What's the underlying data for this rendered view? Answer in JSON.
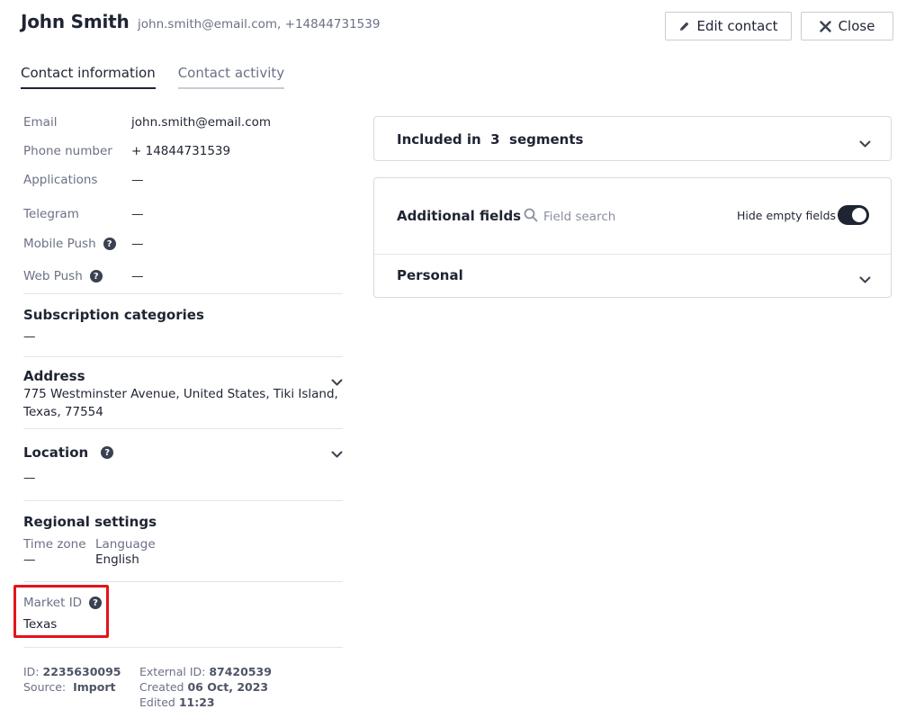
{
  "header": {
    "name": "John Smith",
    "subtitle": "john.smith@email.com, +14844731539",
    "edit_label": "Edit contact",
    "close_label": "Close"
  },
  "tabs": [
    {
      "label": "Contact information",
      "active": true
    },
    {
      "label": "Contact activity",
      "active": false
    }
  ],
  "fields": [
    {
      "label": "Email",
      "value": "john.smith@email.com"
    },
    {
      "label": "Phone number",
      "value": "+ 14844731539"
    },
    {
      "label": "Applications",
      "value": "—"
    },
    {
      "label": "Telegram",
      "value": "—"
    },
    {
      "label": "Mobile Push",
      "value": "—"
    },
    {
      "label": "Web Push",
      "value": "—"
    }
  ],
  "subscription": {
    "title": "Subscription categories",
    "value": "—"
  },
  "address": {
    "title": "Address",
    "line1": "775 Westminster Avenue, United States, Tiki Island,",
    "line2": "Texas, 77554"
  },
  "location": {
    "title": "Location",
    "value": "—"
  },
  "regional": {
    "title": "Regional settings",
    "timezone_label": "Time zone",
    "timezone_value": "—",
    "language_label": "Language",
    "language_value": "English"
  },
  "market": {
    "label": "Market ID",
    "value": "Texas"
  },
  "meta": {
    "id_label": "ID:",
    "id_value": "2235630095",
    "source_label": "Source:",
    "source_value": "Import",
    "external_label": "External ID:",
    "external_value": "87420539",
    "created_label": "Created",
    "created_value": "06 Oct, 2023",
    "edited_label": "Edited",
    "edited_value": "11:23"
  },
  "segments": {
    "prefix": "Included in",
    "count": "3",
    "suffix": "segments"
  },
  "additional": {
    "title": "Additional fields",
    "search_placeholder": "Field search",
    "toggle_label": "Hide empty fields",
    "toggle_on": true,
    "group": "Personal"
  },
  "colors": {
    "accent": "#1f2433",
    "highlight": "#e3141b",
    "muted": "#6b7185"
  }
}
